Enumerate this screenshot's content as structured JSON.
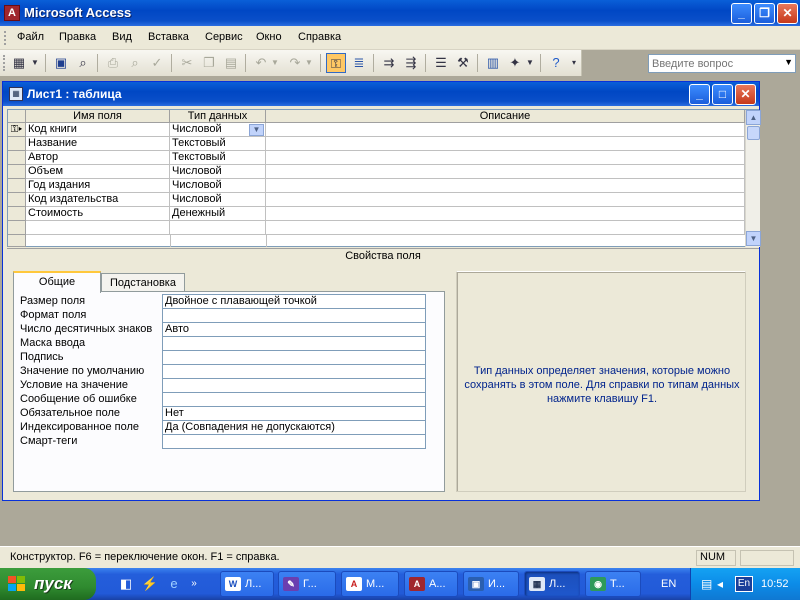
{
  "app": {
    "title": "Microsoft Access",
    "icon": "access-icon"
  },
  "menu": [
    "Файл",
    "Правка",
    "Вид",
    "Вставка",
    "Сервис",
    "Окно",
    "Справка"
  ],
  "help_box": {
    "placeholder": "Введите вопрос"
  },
  "toolbar": {
    "icons": [
      "view-icon",
      "save-icon",
      "search-icon",
      "print-icon",
      "print-preview-icon",
      "spelling-icon",
      "cut-icon",
      "copy-icon",
      "paste-icon",
      "undo-icon",
      "redo-icon",
      "primary-key-icon",
      "indexes-icon",
      "insert-rows-icon",
      "delete-rows-icon",
      "properties-icon",
      "build-icon",
      "database-window-icon",
      "new-object-icon",
      "help-icon"
    ]
  },
  "doc": {
    "title": "Лист1 : таблица"
  },
  "grid": {
    "headers": [
      "Имя поля",
      "Тип данных",
      "Описание"
    ],
    "rows": [
      {
        "name": "Код книги",
        "type": "Числовой",
        "desc": ""
      },
      {
        "name": "Название",
        "type": "Текстовый",
        "desc": ""
      },
      {
        "name": "Автор",
        "type": "Текстовый",
        "desc": ""
      },
      {
        "name": "Объем",
        "type": "Числовой",
        "desc": ""
      },
      {
        "name": "Год издания",
        "type": "Числовой",
        "desc": ""
      },
      {
        "name": "Код издательства",
        "type": "Числовой",
        "desc": ""
      },
      {
        "name": "Стоимость",
        "type": "Денежный",
        "desc": ""
      }
    ]
  },
  "props": {
    "section_title": "Свойства поля",
    "tabs": [
      "Общие",
      "Подстановка"
    ],
    "items": [
      {
        "label": "Размер поля",
        "value": "Двойное с плавающей точкой"
      },
      {
        "label": "Формат поля",
        "value": ""
      },
      {
        "label": "Число десятичных знаков",
        "value": "Авто"
      },
      {
        "label": "Маска ввода",
        "value": ""
      },
      {
        "label": "Подпись",
        "value": ""
      },
      {
        "label": "Значение по умолчанию",
        "value": ""
      },
      {
        "label": "Условие на значение",
        "value": ""
      },
      {
        "label": "Сообщение об ошибке",
        "value": ""
      },
      {
        "label": "Обязательное поле",
        "value": "Нет"
      },
      {
        "label": "Индексированное поле",
        "value": "Да (Совпадения не допускаются)"
      },
      {
        "label": "Смарт-теги",
        "value": ""
      }
    ],
    "description": "Тип данных определяет значения, которые можно сохранять в этом поле.  Для справки по типам данных нажмите клавишу F1."
  },
  "status": {
    "text": "Конструктор.  F6 = переключение окон.  F1 = справка.",
    "num": "NUM"
  },
  "taskbar": {
    "start": "пуск",
    "tasks": [
      "Л...",
      "Г...",
      "М...",
      "А...",
      "И...",
      "Л...",
      "Т..."
    ],
    "lang": "EN",
    "tray_lang": "En",
    "time": "10:52"
  }
}
